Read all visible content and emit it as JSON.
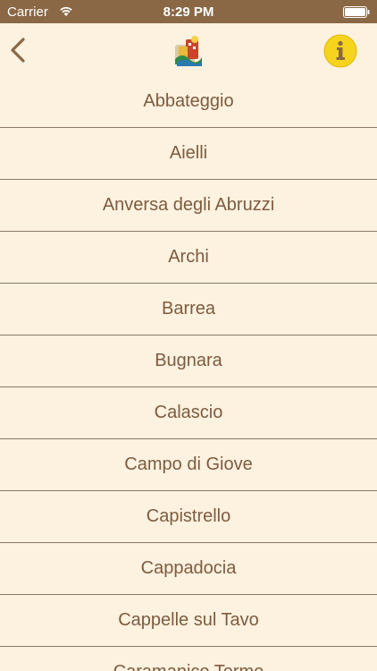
{
  "status_bar": {
    "carrier": "Carrier",
    "time": "8:29 PM",
    "wifi_icon": "wifi-icon",
    "battery_icon": "battery-icon"
  },
  "nav_bar": {
    "back_icon": "chevron-left-icon",
    "logo_icon": "app-logo-icon",
    "info_icon": "info-icon",
    "accent_color": "#8a6845",
    "info_color": "#f6d31c"
  },
  "towns": [
    "Abbateggio",
    "Aielli",
    "Anversa degli Abruzzi",
    "Archi",
    "Barrea",
    "Bugnara",
    "Calascio",
    "Campo di Giove",
    "Capistrello",
    "Cappadocia",
    "Cappelle sul Tavo",
    "Caramanico Terme"
  ]
}
